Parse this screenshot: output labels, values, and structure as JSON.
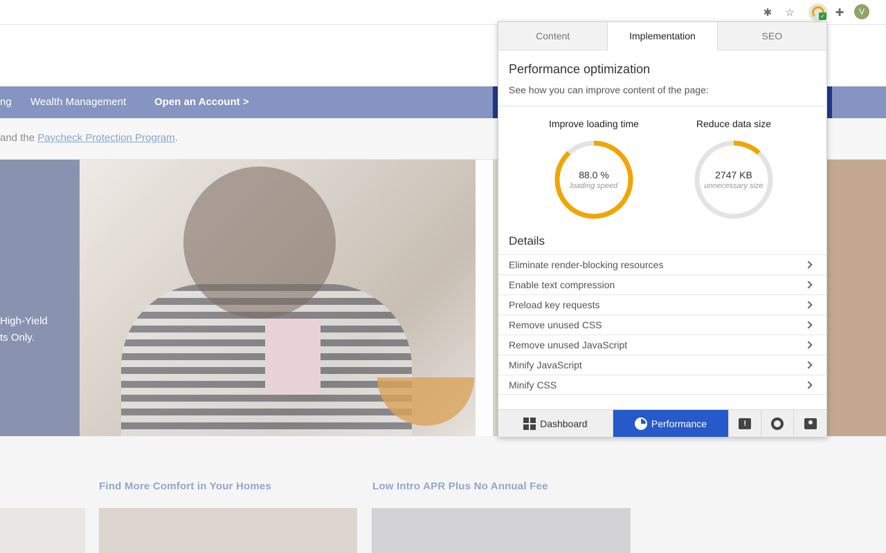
{
  "browser": {
    "avatar_letter": "V",
    "icons": [
      "extension-blocked-icon",
      "star-icon",
      "performance-extension-icon",
      "puzzle-icon"
    ]
  },
  "site": {
    "nav": {
      "partial_left": "ng",
      "wealth": "Wealth Management",
      "open_account": "Open an Account >"
    },
    "alert": {
      "prefix": "and the ",
      "link": "Paycheck Protection Program",
      "suffix": "."
    },
    "hero": {
      "line1": "High-Yield",
      "line2": "ts Only."
    },
    "promos": [
      {
        "title": "Find More Comfort in Your Homes"
      },
      {
        "title": "Low Intro APR Plus No Annual Fee"
      }
    ]
  },
  "popup": {
    "tabs": [
      {
        "label": "Content"
      },
      {
        "label": "Implementation"
      },
      {
        "label": "SEO"
      }
    ],
    "title": "Performance optimization",
    "subtitle": "See how you can improve content of the page:",
    "metrics": [
      {
        "label": "Improve loading time",
        "value": "88.0 %",
        "caption": "loading speed",
        "fraction": 0.88,
        "color": "#f0a500"
      },
      {
        "label": "Reduce data size",
        "value": "2747 KB",
        "caption": "unnecessary size",
        "fraction": 0.12,
        "color": "#f0a500"
      }
    ],
    "details_title": "Details",
    "details": [
      {
        "label": "Eliminate render-blocking resources"
      },
      {
        "label": "Enable text compression"
      },
      {
        "label": "Preload key requests"
      },
      {
        "label": "Remove unused CSS"
      },
      {
        "label": "Remove unused JavaScript"
      },
      {
        "label": "Minify JavaScript"
      },
      {
        "label": "Minify CSS"
      }
    ],
    "bottom": {
      "dashboard": "Dashboard",
      "performance": "Performance",
      "feedback_glyph": "!"
    }
  }
}
